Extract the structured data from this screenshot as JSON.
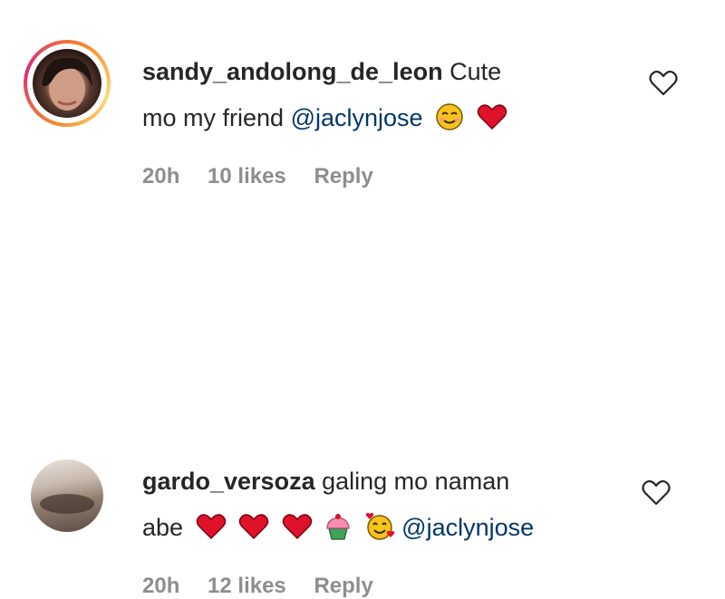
{
  "comments": [
    {
      "username": "sandy_andolong_de_leon",
      "text_line1": "Cute",
      "text_line2": "mo my friend",
      "mention": "@jaclynjose",
      "emojis": [
        "smiling-face-emoji",
        "red-heart-emoji"
      ],
      "time": "20h",
      "likes": "10 likes",
      "reply": "Reply",
      "avatar_ring": true
    },
    {
      "username": "gardo_versoza",
      "text_line1": "galing mo naman",
      "text_line2": "abe",
      "mention": "@jaclynjose",
      "emojis": [
        "red-heart-emoji",
        "red-heart-emoji",
        "red-heart-emoji",
        "cupcake-emoji",
        "smiling-face-with-hearts-emoji"
      ],
      "time": "20h",
      "likes": "12 likes",
      "reply": "Reply",
      "avatar_ring": false
    }
  ],
  "colors": {
    "text": "#262626",
    "mention": "#00376b",
    "meta": "#8e8e8e",
    "heart": "#e0112b"
  },
  "icons": {
    "like": "heart-outline-icon"
  }
}
